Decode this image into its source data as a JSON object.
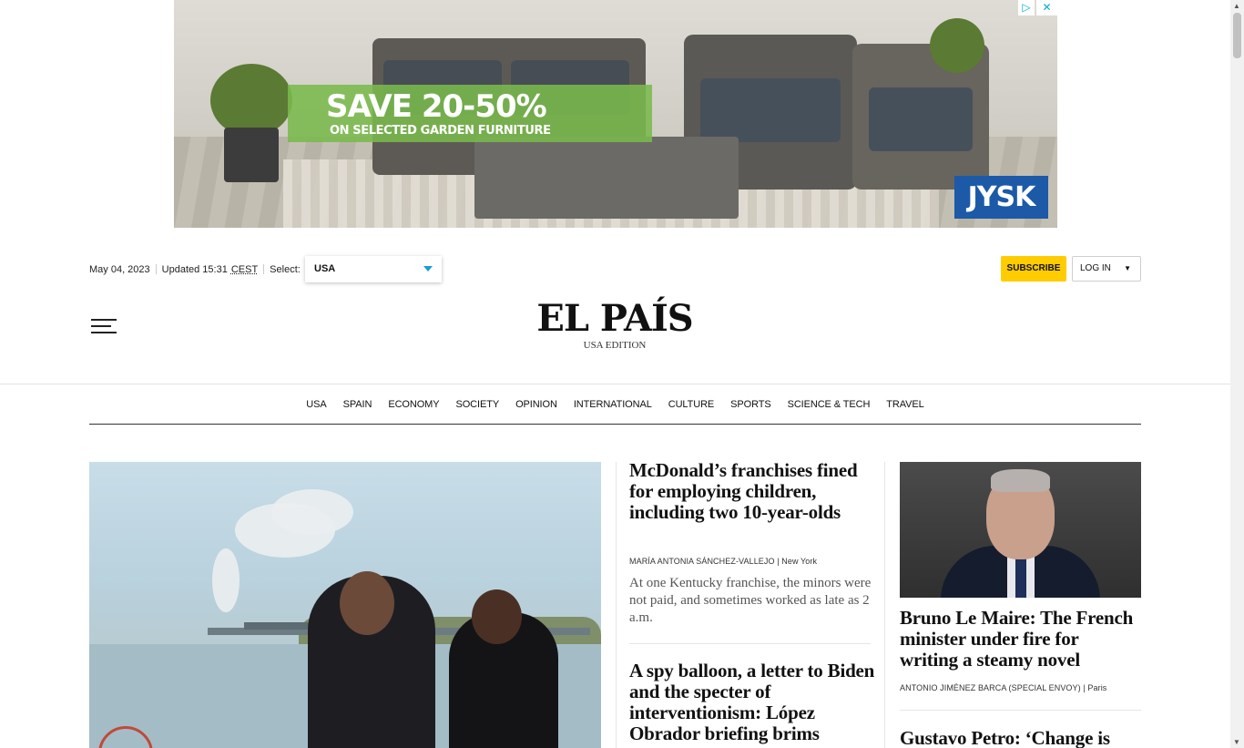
{
  "ad": {
    "headline": "SAVE 20-50%",
    "subline": "ON SELECTED GARDEN FURNITURE",
    "brand": "JYSK",
    "adchoices_icon": "adchoices-icon",
    "close_icon": "close-icon"
  },
  "topbar": {
    "date": "May 04, 2023",
    "updated": "Updated 15:31",
    "timezone": "CEST",
    "select_label": "Select:",
    "select_value": "USA",
    "subscribe": "SUBSCRIBE",
    "login": "LOG IN",
    "login_caret": "▼"
  },
  "header": {
    "logo": "EL PAÍS",
    "edition": "USA EDITION",
    "menu_icon": "hamburger-menu-icon"
  },
  "nav": {
    "items": [
      "USA",
      "SPAIN",
      "ECONOMY",
      "SOCIETY",
      "OPINION",
      "INTERNATIONAL",
      "CULTURE",
      "SPORTS",
      "SCIENCE & TECH",
      "TRAVEL"
    ]
  },
  "stories": [
    {
      "headline": "McDonald’s franchises fined for employing children, including two 10-year-olds",
      "byline": "MARÍA ANTONIA SÁNCHEZ-VALLEJO",
      "location": "New York",
      "summary": "At one Kentucky franchise, the minors were not paid, and sometimes worked as late as 2 a.m."
    },
    {
      "headline": "A spy balloon, a letter to Biden and the specter of interventionism: López Obrador briefing brims"
    },
    {
      "headline": "Bruno Le Maire: The French minister under fire for writing a steamy novel",
      "byline": "ANTONIO JIMÉNEZ BARCA (SPECIAL ENVOY)",
      "location": "Paris"
    },
    {
      "headline": "Gustavo Petro: ‘Change is"
    }
  ],
  "colors": {
    "subscribe_bg": "#ffcc00",
    "select_arrow": "#1e9bd7",
    "ad_green": "#7aba4c",
    "jysk_blue": "#1c5aa8"
  }
}
